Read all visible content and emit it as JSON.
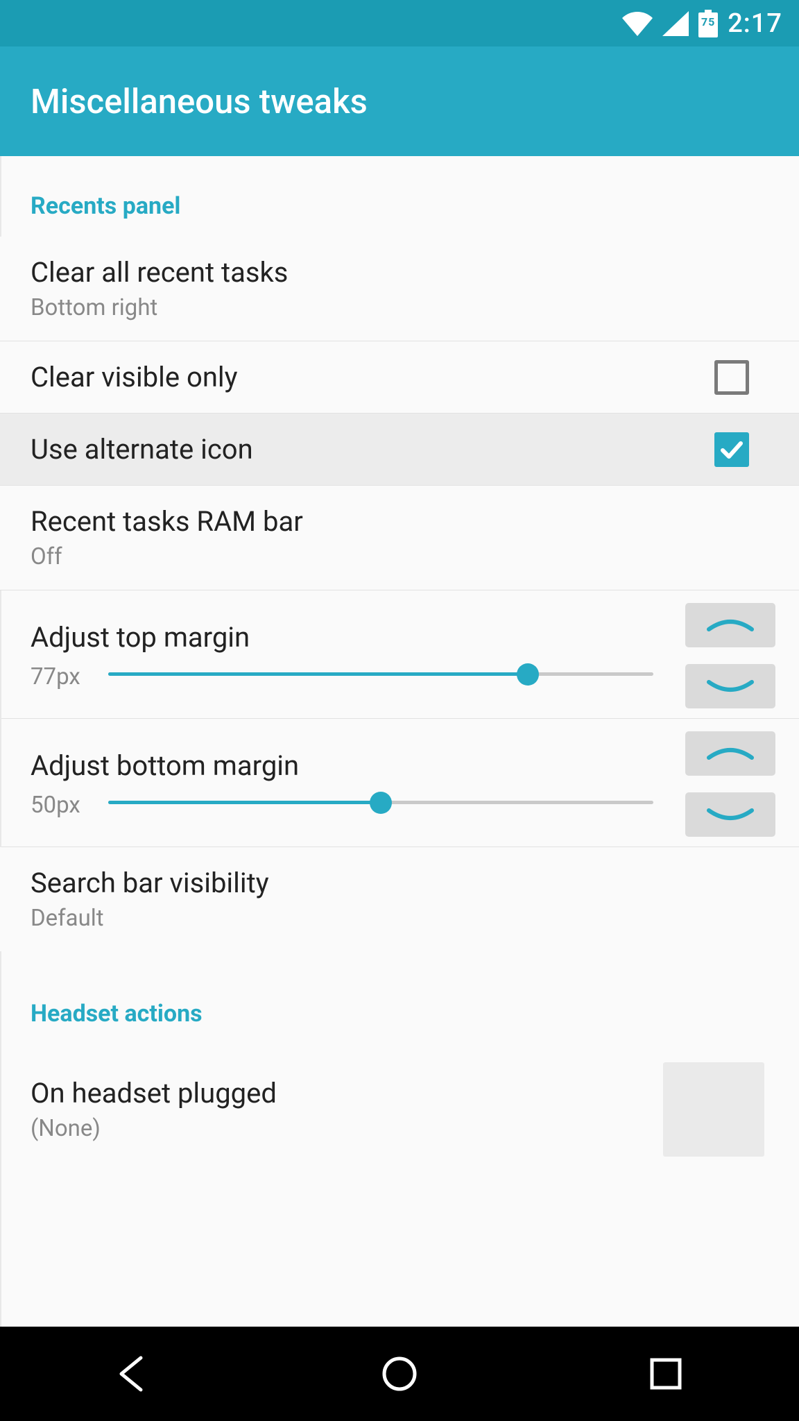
{
  "statusbar": {
    "time": "2:17",
    "battery_percent": "75"
  },
  "appbar": {
    "title": "Miscellaneous tweaks"
  },
  "sections": {
    "recents_panel": {
      "header": "Recents panel",
      "clear_all": {
        "title": "Clear all recent tasks",
        "value": "Bottom right"
      },
      "clear_visible": {
        "title": "Clear visible only",
        "checked": false
      },
      "alt_icon": {
        "title": "Use alternate icon",
        "checked": true
      },
      "ram_bar": {
        "title": "Recent tasks RAM bar",
        "value": "Off"
      },
      "top_margin": {
        "title": "Adjust top margin",
        "value": "77px",
        "percent": 77
      },
      "bottom_margin": {
        "title": "Adjust bottom margin",
        "value": "50px",
        "percent": 50
      },
      "search_bar": {
        "title": "Search bar visibility",
        "value": "Default"
      }
    },
    "headset": {
      "header": "Headset actions",
      "plugged": {
        "title": "On headset plugged",
        "value": "(None)"
      }
    }
  },
  "colors": {
    "accent": "#27aac4",
    "statusbar": "#1b9cb3"
  }
}
